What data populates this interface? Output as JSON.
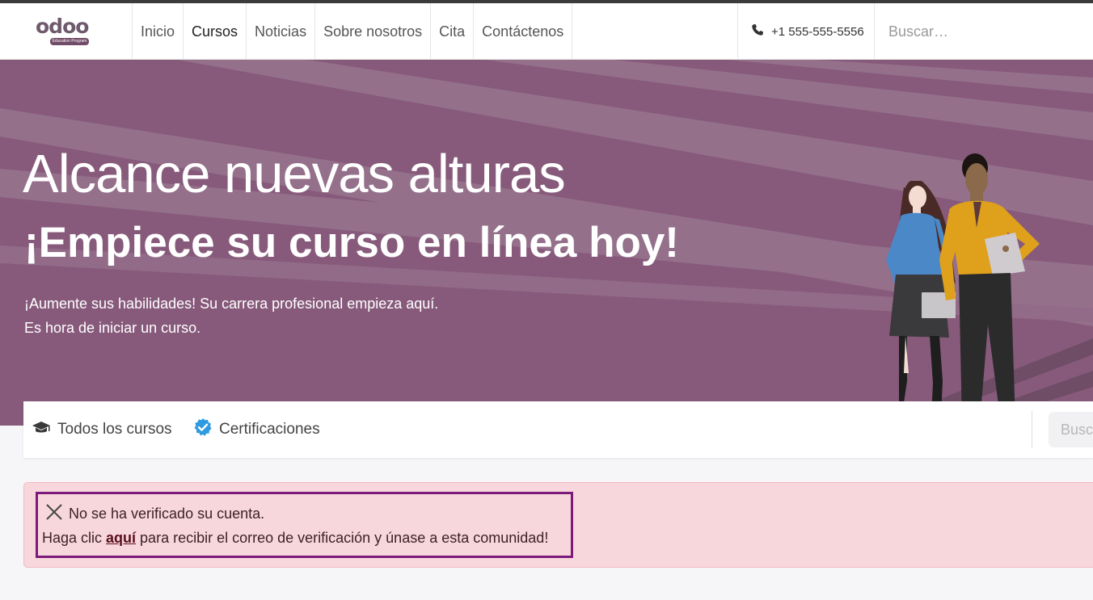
{
  "brand": {
    "logo_text": "odoo",
    "logo_subtitle": "Education Program"
  },
  "nav": {
    "items": [
      {
        "label": "Inicio"
      },
      {
        "label": "Cursos"
      },
      {
        "label": "Noticias"
      },
      {
        "label": "Sobre nosotros"
      },
      {
        "label": "Cita"
      },
      {
        "label": "Contáctenos"
      }
    ],
    "active": "Cursos",
    "phone": "+1 555-555-5556",
    "search_placeholder": "Buscar…"
  },
  "hero": {
    "title": "Alcance nuevas alturas",
    "subtitle": "¡Empiece su curso en línea hoy!",
    "line1": "¡Aumente sus habilidades! Su carrera profesional empieza aquí.",
    "line2": "Es hora de iniciar un curso."
  },
  "subnav": {
    "all_courses": "Todos los cursos",
    "certifications": "Certificaciones",
    "search_placeholder": "Buscar"
  },
  "alert": {
    "line1": "No se ha verificado su cuenta.",
    "line2_prefix": "Haga clic ",
    "link_label": "aquí",
    "line2_suffix": " para recibir el correo de verificación y únase a esta comunidad!"
  },
  "colors": {
    "brand": "#714b67",
    "hero_bg": "#875a7b",
    "alert_bg": "#f7d7dc",
    "alert_highlight": "#7b1a7b",
    "certified_blue": "#2e9be0"
  },
  "icons": [
    "phone-icon",
    "graduation-cap-icon",
    "verified-check-icon",
    "close-icon"
  ]
}
